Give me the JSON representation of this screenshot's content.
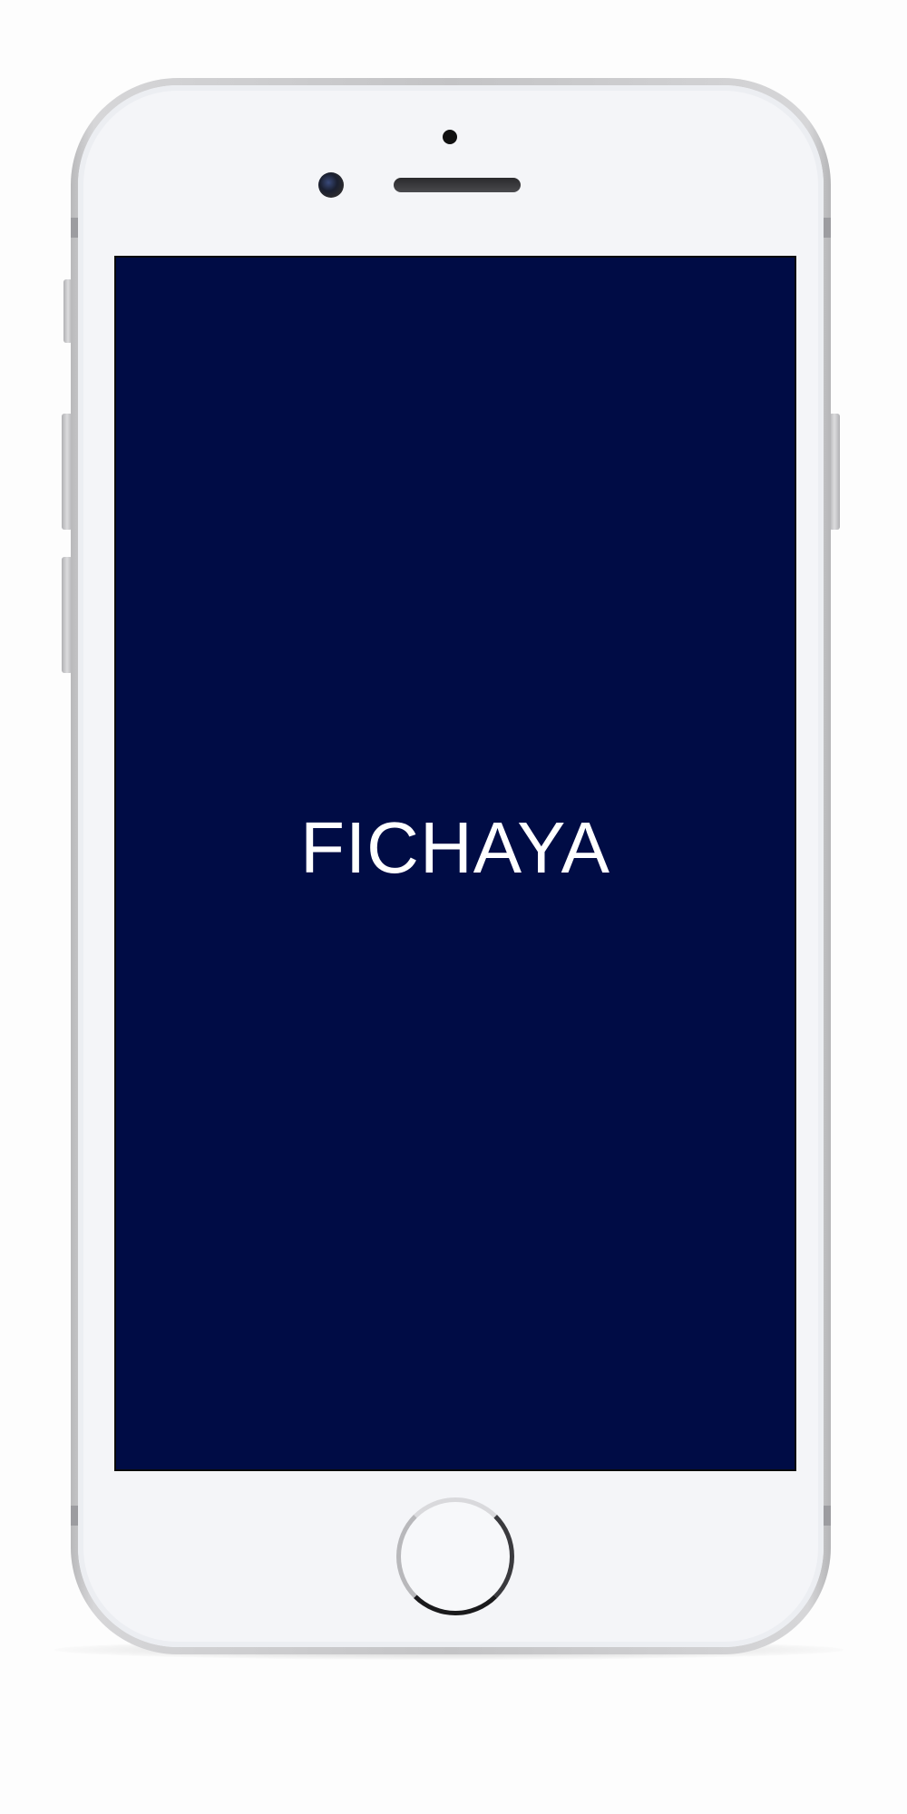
{
  "app": {
    "logo_text": "FICHAYA",
    "background_color": "#000c45",
    "text_color": "#ffffff"
  },
  "device": {
    "frame_color": "#c3c3c5",
    "face_color": "#f4f5f8",
    "icons": [
      "camera-icon",
      "earpiece",
      "home-button"
    ]
  }
}
